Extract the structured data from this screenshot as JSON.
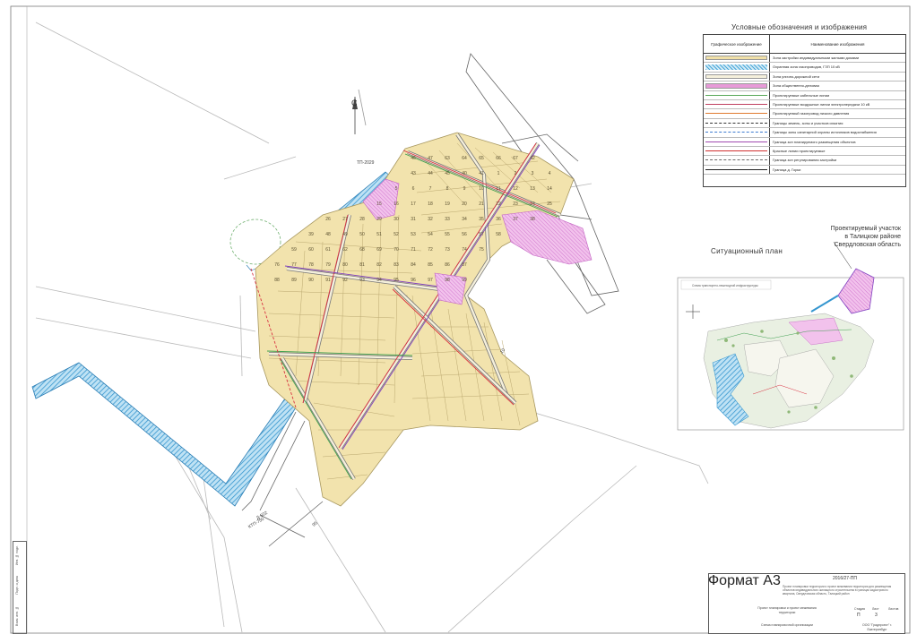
{
  "legend": {
    "title": "Условные обозначения и изображения",
    "header_symbol": "Графическое изображение",
    "header_name": "Наименование изображения",
    "items": [
      {
        "label": "Зона застройки индивидуальными жилыми домами",
        "color": "#f0e0a8",
        "kind": "fill"
      },
      {
        "label": "Охранная зона газопроводов, ГЗП 10 кВ",
        "color": "#4aa8d8",
        "kind": "hatch"
      },
      {
        "label": "Зона улично-дорожной сети",
        "color": "#f5f0dc",
        "kind": "fill"
      },
      {
        "label": "Зона общественно-деловая",
        "color": "#e79ad8",
        "kind": "fill"
      },
      {
        "label": "Проектируемые кабельные линии",
        "color": "#58a858",
        "kind": "line"
      },
      {
        "label": "Проектируемые воздушные линии электропередачи 10 кВ",
        "color": "#c04060",
        "kind": "line"
      },
      {
        "label": "Проектируемый газопровод низкого давления",
        "color": "#e07a30",
        "kind": "line"
      },
      {
        "label": "Границы земель, зоны и участков изъятия",
        "color": "#333333",
        "kind": "dash"
      },
      {
        "label": "Границы зоны санитарной охраны источников водоснабжения",
        "color": "#3c7ad0",
        "kind": "dash"
      },
      {
        "label": "Граница зон планируемого размещения объектов",
        "color": "#a04ab0",
        "kind": "line"
      },
      {
        "label": "Красные линии проектируемые",
        "color": "#d03030",
        "kind": "line"
      },
      {
        "label": "Граница зон регулирования застройки",
        "color": "#666666",
        "kind": "dash"
      },
      {
        "label": "Граница д. Горки",
        "color": "#222222",
        "kind": "line"
      }
    ]
  },
  "map": {
    "north_label": "С",
    "plot_numbers": [
      "46",
      "47",
      "63",
      "64",
      "65",
      "66",
      "67",
      "42",
      "43",
      "44",
      "45",
      "40",
      "41",
      "1",
      "2",
      "3",
      "4",
      "5",
      "6",
      "7",
      "8",
      "9",
      "10",
      "11",
      "12",
      "13",
      "14",
      "15",
      "16",
      "17",
      "18",
      "19",
      "20",
      "21",
      "22",
      "23",
      "24",
      "25",
      "26",
      "27",
      "28",
      "29",
      "30",
      "31",
      "32",
      "33",
      "34",
      "35",
      "36",
      "37",
      "38",
      "39",
      "48",
      "49",
      "50",
      "51",
      "52",
      "53",
      "54",
      "55",
      "56",
      "57",
      "58",
      "59",
      "60",
      "61",
      "62",
      "68",
      "69",
      "70",
      "71",
      "72",
      "73",
      "74",
      "75",
      "76",
      "77",
      "78",
      "79",
      "80",
      "81",
      "82",
      "83",
      "84",
      "85",
      "86",
      "87",
      "88",
      "89",
      "90",
      "91",
      "92",
      "93",
      "94",
      "95",
      "96",
      "97",
      "98",
      "99"
    ],
    "road_label_top": "ТП-2029",
    "road_label_bottom": "Д-502",
    "road_label_bottom2": "КТП-750",
    "road_label_mid": "95",
    "road_label_right": "10"
  },
  "situation": {
    "title": "Ситуационный план",
    "site_label": "Проектируемый участок\nв Талицком районе\nСвердловская область",
    "inset_header": "Схема транспортно-пешеходной инфраструктуры"
  },
  "colors": {
    "plots": "#f2e3ad",
    "plot_edge": "#a89860",
    "water_hatch": "#4ba7d6",
    "road_edge": "#555555",
    "public_zone": "#e8a0dc",
    "red_line": "#d83040",
    "green_line": "#3fa050",
    "purple_line": "#8040c0"
  },
  "stamp": {
    "code": "2016/27-ПП",
    "description": "Проект планировки территории и проект межевания территории для размещения объектов индивидуального жилищного строительства в границах кадастрового квартала, Свердловская область, Талицкий район",
    "project": "Проект планировки и проект межевания территории",
    "sheet_name": "Схема планировочной организации",
    "org": "ООО \"Градпроект\" г. Екатеринбург",
    "stage_label": "Стадия",
    "sheet_label": "Лист",
    "sheets_label": "Листов",
    "stage": "П",
    "sheet": "3",
    "format": "Формат А3"
  },
  "side_strip": {
    "line1": "Инв. № подл.",
    "line2": "Подп. и дата",
    "line3": "Взам. инв. №"
  }
}
